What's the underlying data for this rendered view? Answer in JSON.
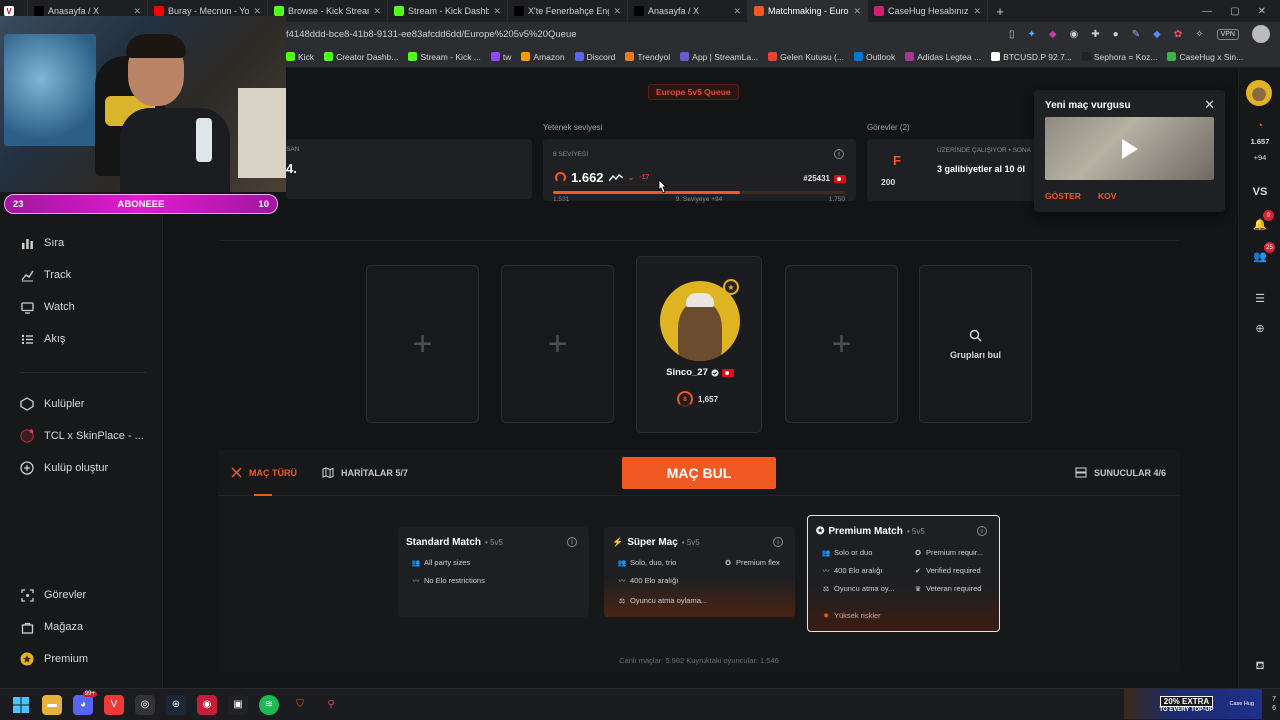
{
  "browser": {
    "tabs": [
      {
        "title": "Anasayfa / X",
        "color": "#000000"
      },
      {
        "title": "Buray - Mecnun - YouTube",
        "color": "#ff0000"
      },
      {
        "title": "Browse - Kick Streaming",
        "color": "#53fc18"
      },
      {
        "title": "Stream - Kick Dashboard",
        "color": "#53fc18"
      },
      {
        "title": "X'te Fenerbahçe English: \"S",
        "color": "#000000"
      },
      {
        "title": "Anasayfa / X",
        "color": "#000000"
      },
      {
        "title": "Matchmaking - Europe 5v5",
        "color": "#f05a22"
      },
      {
        "title": "CaseHug Hesabınız – Envar",
        "color": "#d21f6e"
      }
    ],
    "url": "f4148ddd-bce8-41b8-9131-ee83afcdd6dd/Europe%205v5%20Queue",
    "vpn_label": "VPN",
    "bookmarks": [
      {
        "label": "Kick",
        "color": "#53fc18"
      },
      {
        "label": "Creator Dashb...",
        "color": "#53fc18"
      },
      {
        "label": "Stream - Kick ...",
        "color": "#53fc18"
      },
      {
        "label": "tw",
        "color": "#9146ff"
      },
      {
        "label": "Amazon",
        "color": "#ff9900"
      },
      {
        "label": "Discord",
        "color": "#5865f2"
      },
      {
        "label": "Trendyol",
        "color": "#f27a1a"
      },
      {
        "label": "App | StreamLa...",
        "color": "#6a5acd"
      },
      {
        "label": "Gelen Kutusu (...",
        "color": "#ea4335"
      },
      {
        "label": "Outlook",
        "color": "#0078d4"
      },
      {
        "label": "Adidas Legtea ...",
        "color": "#aa3399"
      },
      {
        "label": "BTCUSD.P 92.7...",
        "color": "#ffffff"
      },
      {
        "label": "Sephora = Koz...",
        "color": "#222222"
      },
      {
        "label": "CaseHug x Sin...",
        "color": "#3bb54a"
      }
    ]
  },
  "overlay": {
    "sub_goal": {
      "current": "23",
      "label": "ABONEEE",
      "target": "10"
    }
  },
  "sidebar": {
    "top_items": [
      {
        "label": "Sıra",
        "icon": "bar-chart-icon"
      },
      {
        "label": "Track",
        "icon": "trend-line-icon"
      },
      {
        "label": "Watch",
        "icon": "monitor-icon"
      },
      {
        "label": "Akış",
        "icon": "feed-list-icon"
      }
    ],
    "club_items": [
      {
        "label": "Kulüpler",
        "icon": "clubs-icon"
      },
      {
        "label": "TCL x SkinPlace - ...",
        "icon": "club-avatar-icon"
      },
      {
        "label": "Kulüp oluştur",
        "icon": "plus-circle-icon"
      }
    ],
    "bottom_items": [
      {
        "label": "Görevler",
        "icon": "target-icon"
      },
      {
        "label": "Mağaza",
        "icon": "shop-bag-icon"
      },
      {
        "label": "Premium",
        "icon": "premium-star-icon"
      }
    ]
  },
  "main": {
    "queue_label": "Europe 5v5 Queue",
    "left_card": {
      "label_suffix": "SAN",
      "value_suffix": "4."
    },
    "skill": {
      "section_label": "Yetenek seviyesi",
      "level_label": "8 SEVİYESİ",
      "elo": "1.662",
      "delta": "-17",
      "rank": "#25431",
      "min": "1.531",
      "next_label": "9. Seviyeye +94",
      "max": "1.750",
      "progress": 0.64
    },
    "tasks": {
      "section_label": "Görevler (2)",
      "grade": "F",
      "points": "200",
      "working_label": "ÜZERİNDE ÇALIŞIYOR • SONA",
      "task_text": "3 galibiyetler al 10 öl"
    },
    "party": {
      "player": {
        "name": "Sinco_27",
        "level": "8",
        "elo": "1,657"
      },
      "find_groups_label": "Grupları bul"
    },
    "toolbar": {
      "match_type": "MAÇ TÜRÜ",
      "maps": "HARİTALAR 5/7",
      "find_match": "MAÇ BUL",
      "servers": "SUNUCULAR 4/6"
    },
    "modes": [
      {
        "title": "Standard Match",
        "sub": "• 5v5",
        "features": [
          "All party sizes",
          "No Elo restrictions"
        ]
      },
      {
        "title": "Süper Maç",
        "sub": "• 5v5",
        "features": [
          "Solo, duo, trio",
          "Premium flex",
          "400 Elo aralığı",
          "Oyuncu atma oylama..."
        ]
      },
      {
        "title": "Premium Match",
        "sub": "• 5v5",
        "features": [
          "Solo or duo",
          "Premium requir...",
          "400 Elo aralığı",
          "Verified required",
          "Oyuncu atma oy...",
          "Veteran required",
          "Yüksek riskler"
        ]
      }
    ],
    "stats": "Canlı maçlar: 5.982   Kuyruktaki oyuncular: 1.546"
  },
  "popup": {
    "title": "Yeni maç vurgusu",
    "show": "GÖSTER",
    "dismiss": "KOV"
  },
  "rail": {
    "elo": "1.657",
    "delta": "+94",
    "vs": "VS",
    "notif_count": "9",
    "friends_count": "25"
  },
  "taskbar": {
    "promo_big": "20% EXTRA",
    "promo_small": "TO EVERY TOP-UP",
    "promo_brand": "Case Hug",
    "time_a": "7",
    "time_b": "6",
    "discord_badge": "99+"
  }
}
